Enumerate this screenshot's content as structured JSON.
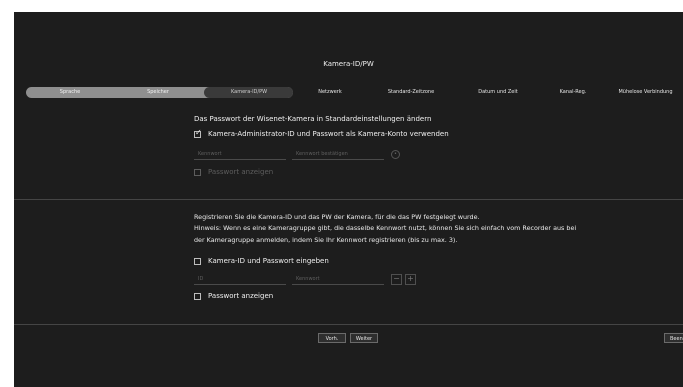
{
  "page_title": "Kamera-ID/PW",
  "steps": {
    "language": "Sprache",
    "storage": "Speicher",
    "camera_id_pw": "Kamera-ID/PW",
    "network": "Netzwerk",
    "timezone": "Standard-Zeitzone",
    "datetime": "Datum und Zeit",
    "channel_reg": "Kanal-Reg.",
    "easy_connect": "Mühelose Verbindung"
  },
  "section1": {
    "title": "Das Passwort der Wisenet-Kamera in Standardeinstellungen ändern",
    "use_admin_label": "Kamera-Administrator-ID und Passwort als Kamera-Konto verwenden",
    "password_placeholder": "Kennwort",
    "confirm_placeholder": "Kennwort bestätigen",
    "show_password_label": "Passwort anzeigen"
  },
  "section2": {
    "line1": "Registrieren Sie die Kamera-ID und das PW der Kamera, für die das PW festgelegt wurde.",
    "line2": "Hinweis: Wenn es eine Kameragruppe gibt, die dasselbe Kennwort nutzt, können Sie sich einfach vom Recorder aus bei",
    "line3": "der Kameragruppe anmelden, indem Sie Ihr Kennwort registrieren (bis zu max. 3).",
    "enter_id_pw_label": "Kamera-ID und Passwort eingeben",
    "id_placeholder": "ID",
    "password_placeholder": "Kennwort",
    "minus_symbol": "−",
    "plus_symbol": "+",
    "show_password_label": "Passwort anzeigen"
  },
  "footer": {
    "prev": "Vorh.",
    "next": "Weiter",
    "finish": "Beenden"
  }
}
